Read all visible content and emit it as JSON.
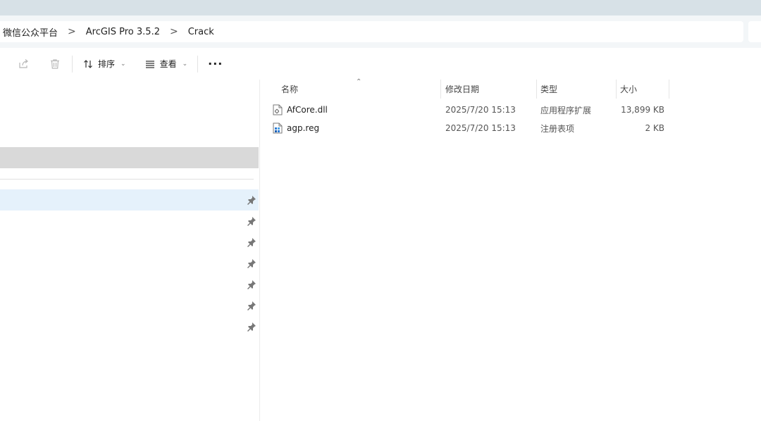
{
  "breadcrumb": {
    "items": [
      "微信公众平台",
      "ArcGIS Pro 3.5.2",
      "Crack"
    ],
    "separator": ">"
  },
  "toolbar": {
    "share_icon": "share-icon",
    "delete_icon": "trash-icon",
    "sort_label": "排序",
    "view_label": "查看",
    "more_label": "···"
  },
  "columns": {
    "name": "名称",
    "modified": "修改日期",
    "type": "类型",
    "size": "大小"
  },
  "files": [
    {
      "name": "AfCore.dll",
      "modified": "2025/7/20 15:13",
      "type": "应用程序扩展",
      "size": "13,899 KB",
      "icon": "dll-file-icon"
    },
    {
      "name": "agp.reg",
      "modified": "2025/7/20 15:13",
      "type": "注册表项",
      "size": "2 KB",
      "icon": "reg-file-icon"
    }
  ],
  "colors": {
    "titlebar": "#d7e1e7",
    "nav_selected": "#d9d9d9",
    "nav_hover": "#e5f1fb"
  }
}
